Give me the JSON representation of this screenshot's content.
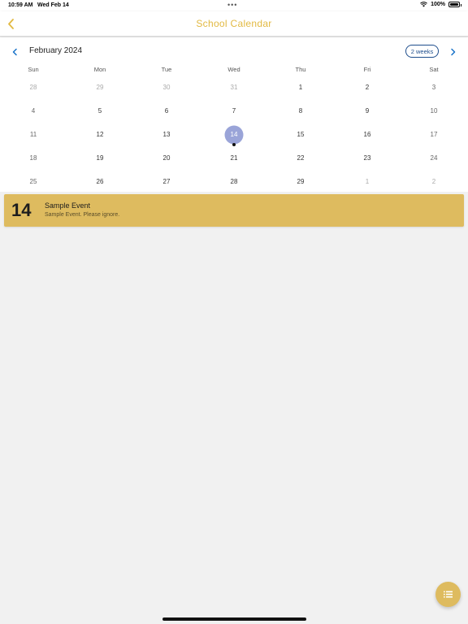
{
  "status_bar": {
    "time": "10:59 AM",
    "date": "Wed Feb 14",
    "battery": "100%"
  },
  "nav": {
    "title": "School Calendar"
  },
  "calendar": {
    "month_label": "February 2024",
    "format_button": "2 weeks",
    "weekdays": [
      "Sun",
      "Mon",
      "Tue",
      "Wed",
      "Thu",
      "Fri",
      "Sat"
    ],
    "weeks": [
      [
        "28",
        "29",
        "30",
        "31",
        "1",
        "2",
        "3"
      ],
      [
        "4",
        "5",
        "6",
        "7",
        "8",
        "9",
        "10"
      ],
      [
        "11",
        "12",
        "13",
        "14",
        "15",
        "16",
        "17"
      ],
      [
        "18",
        "19",
        "20",
        "21",
        "22",
        "23",
        "24"
      ],
      [
        "25",
        "26",
        "27",
        "28",
        "29",
        "1",
        "2"
      ]
    ],
    "selected_day": "14",
    "event_marker_day": "14"
  },
  "event": {
    "day": "14",
    "title": "Sample Event",
    "description": "Sample Event. Please ignore."
  },
  "icons": {
    "back": "chevron-left-icon",
    "prev_month": "chevron-left-icon",
    "next_month": "chevron-right-icon",
    "fab": "list-icon",
    "wifi": "wifi-icon",
    "battery": "battery-icon"
  },
  "colors": {
    "accent": "#e2b941",
    "event_card": "#debb5f",
    "selected_day": "#9aa4d8",
    "link_blue": "#1e4d8c"
  }
}
